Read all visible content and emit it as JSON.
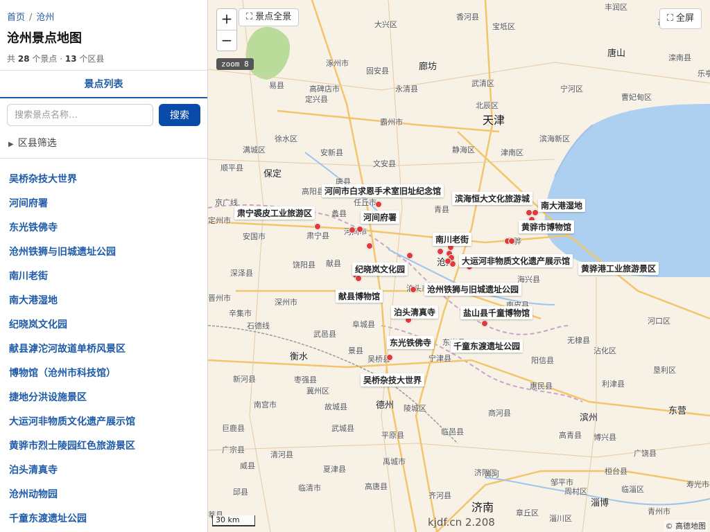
{
  "breadcrumb": {
    "home": "首页",
    "separator": "/",
    "current": "沧州"
  },
  "page": {
    "title": "沧州景点地图",
    "stats": {
      "prefix": "共",
      "spots": "28",
      "spots_unit": "个景点 ·",
      "districts": "13",
      "districts_unit": "个区县"
    }
  },
  "tabs": {
    "active": "景点列表"
  },
  "search": {
    "placeholder": "搜索景点名称…",
    "button": "搜索"
  },
  "filter": {
    "label": "区县筛选"
  },
  "spots": [
    "吴桥杂技大世界",
    "河间府署",
    "东光铁佛寺",
    "沧州铁狮与旧城遗址公园",
    "南川老街",
    "南大港湿地",
    "纪晓岚文化园",
    "献县滹沱河故道单桥风景区",
    "博物馆（沧州市科技馆）",
    "捷地分洪设施景区",
    "大运河非物质文化遗产展示馆",
    "黄骅市烈士陵园红色旅游景区",
    "泊头清真寺",
    "沧州动物园",
    "千童东渡遗址公园"
  ],
  "map": {
    "zoom_in": "+",
    "zoom_out": "−",
    "overview_button": "景点全景",
    "fullscreen_button": "全屏",
    "zoom_badge": "zoom 8",
    "scale": "30 km",
    "watermark": "kjdf.cn 2.208",
    "attribution": "© 高德地图",
    "colors": {
      "poi": "#e03a3a",
      "water": "#aed0f0",
      "land": "#f7f1e6",
      "accent": "#1e5aa8"
    },
    "places": [
      {
        "name": "首页",
        "cls": "hidden"
      },
      {
        "name": "丰润区"
      },
      {
        "name": "古冶"
      },
      {
        "name": "宝坻区"
      },
      {
        "name": "香河县"
      },
      {
        "name": "大兴区"
      },
      {
        "name": "唐山",
        "cls": "city"
      },
      {
        "name": "滦南县"
      },
      {
        "name": "乐亭"
      },
      {
        "name": "廊坊",
        "cls": "city"
      },
      {
        "name": "涿州市"
      },
      {
        "name": "固安县"
      },
      {
        "name": "永清县"
      },
      {
        "name": "武清区"
      },
      {
        "name": "宁河区"
      },
      {
        "name": "易县"
      },
      {
        "name": "高碑店市"
      },
      {
        "name": "北辰区"
      },
      {
        "name": "曹妃甸区"
      },
      {
        "name": "定兴县"
      },
      {
        "name": "天津",
        "cls": "big"
      },
      {
        "name": "霸州市"
      },
      {
        "name": "滨海新区"
      },
      {
        "name": "徐水区"
      },
      {
        "name": "满城区"
      },
      {
        "name": "安新县"
      },
      {
        "name": "静海区"
      },
      {
        "name": "津南区"
      },
      {
        "name": "顺平县"
      },
      {
        "name": "保定",
        "cls": "city"
      },
      {
        "name": "文安县"
      },
      {
        "name": "唐县"
      },
      {
        "name": "高阳县"
      },
      {
        "name": "任丘市"
      },
      {
        "name": "青县"
      },
      {
        "name": "蠡县"
      },
      {
        "name": "安国市"
      },
      {
        "name": "肃宁县"
      },
      {
        "name": "河间市"
      },
      {
        "name": "黄骅"
      },
      {
        "name": "定州市"
      },
      {
        "name": "泊头市"
      },
      {
        "name": "沧州",
        "cls": "city"
      },
      {
        "name": "饶阳县"
      },
      {
        "name": "深泽县"
      },
      {
        "name": "献县"
      },
      {
        "name": "海兴县"
      },
      {
        "name": "晋州市"
      },
      {
        "name": "深州市"
      },
      {
        "name": "南皮县"
      },
      {
        "name": "辛集市"
      },
      {
        "name": "阜城县"
      },
      {
        "name": "河口区"
      },
      {
        "name": "武邑县"
      },
      {
        "name": "东光县"
      },
      {
        "name": "无棣县"
      },
      {
        "name": "衡水",
        "cls": "city"
      },
      {
        "name": "景县"
      },
      {
        "name": "吴桥县"
      },
      {
        "name": "宁津县"
      },
      {
        "name": "沾化区"
      },
      {
        "name": "新河县"
      },
      {
        "name": "冀州区"
      },
      {
        "name": "枣强县"
      },
      {
        "name": "阳信县"
      },
      {
        "name": "垦利区"
      },
      {
        "name": "德州",
        "cls": "city"
      },
      {
        "name": "陵城区"
      },
      {
        "name": "惠民县"
      },
      {
        "name": "利津县"
      },
      {
        "name": "南宫市"
      },
      {
        "name": "故城县"
      },
      {
        "name": "滨州",
        "cls": "city"
      },
      {
        "name": "东营",
        "cls": "city"
      },
      {
        "name": "巨鹿县"
      },
      {
        "name": "武城县"
      },
      {
        "name": "平原县"
      },
      {
        "name": "临邑县"
      },
      {
        "name": "商河县"
      },
      {
        "name": "高青县"
      },
      {
        "name": "博兴县"
      },
      {
        "name": "广宗县"
      },
      {
        "name": "清河县"
      },
      {
        "name": "广饶县"
      },
      {
        "name": "威县"
      },
      {
        "name": "夏津县"
      },
      {
        "name": "禹城市"
      },
      {
        "name": "济阳区"
      },
      {
        "name": "黄河"
      },
      {
        "name": "邹平市"
      },
      {
        "name": "桓台县"
      },
      {
        "name": "寿光市"
      },
      {
        "name": "高唐县"
      },
      {
        "name": "周村区"
      },
      {
        "name": "临淄区"
      },
      {
        "name": "临清市"
      },
      {
        "name": "齐河县"
      },
      {
        "name": "淄博",
        "cls": "city"
      },
      {
        "name": "邱县"
      },
      {
        "name": "济南",
        "cls": "big"
      },
      {
        "name": "章丘区"
      },
      {
        "name": "淄川区"
      },
      {
        "name": "青州市"
      },
      {
        "name": "莘县"
      },
      {
        "name": "南和区"
      },
      {
        "name": "石德线"
      },
      {
        "name": "京广线"
      },
      {
        "name": "泊头"
      },
      {
        "name": "吴桥"
      }
    ],
    "poi_labels": [
      "河间市白求恩手术室旧址纪念馆",
      "滨海恒大文化旅游城",
      "南大港湿地",
      "肃宁裘皮工业旅游区",
      "河间府署",
      "黄骅市博物馆",
      "南川老街",
      "大运河非物质文化遗产展示馆",
      "纪晓岚文化园",
      "黄骅港工业旅游景区",
      "沧州铁狮与旧城遗址公园",
      "献县博物馆",
      "泊头清真寺",
      "盐山县千童博物馆",
      "东光铁佛寺",
      "千童东渡遗址公园",
      "吴桥杂技大世界"
    ]
  }
}
